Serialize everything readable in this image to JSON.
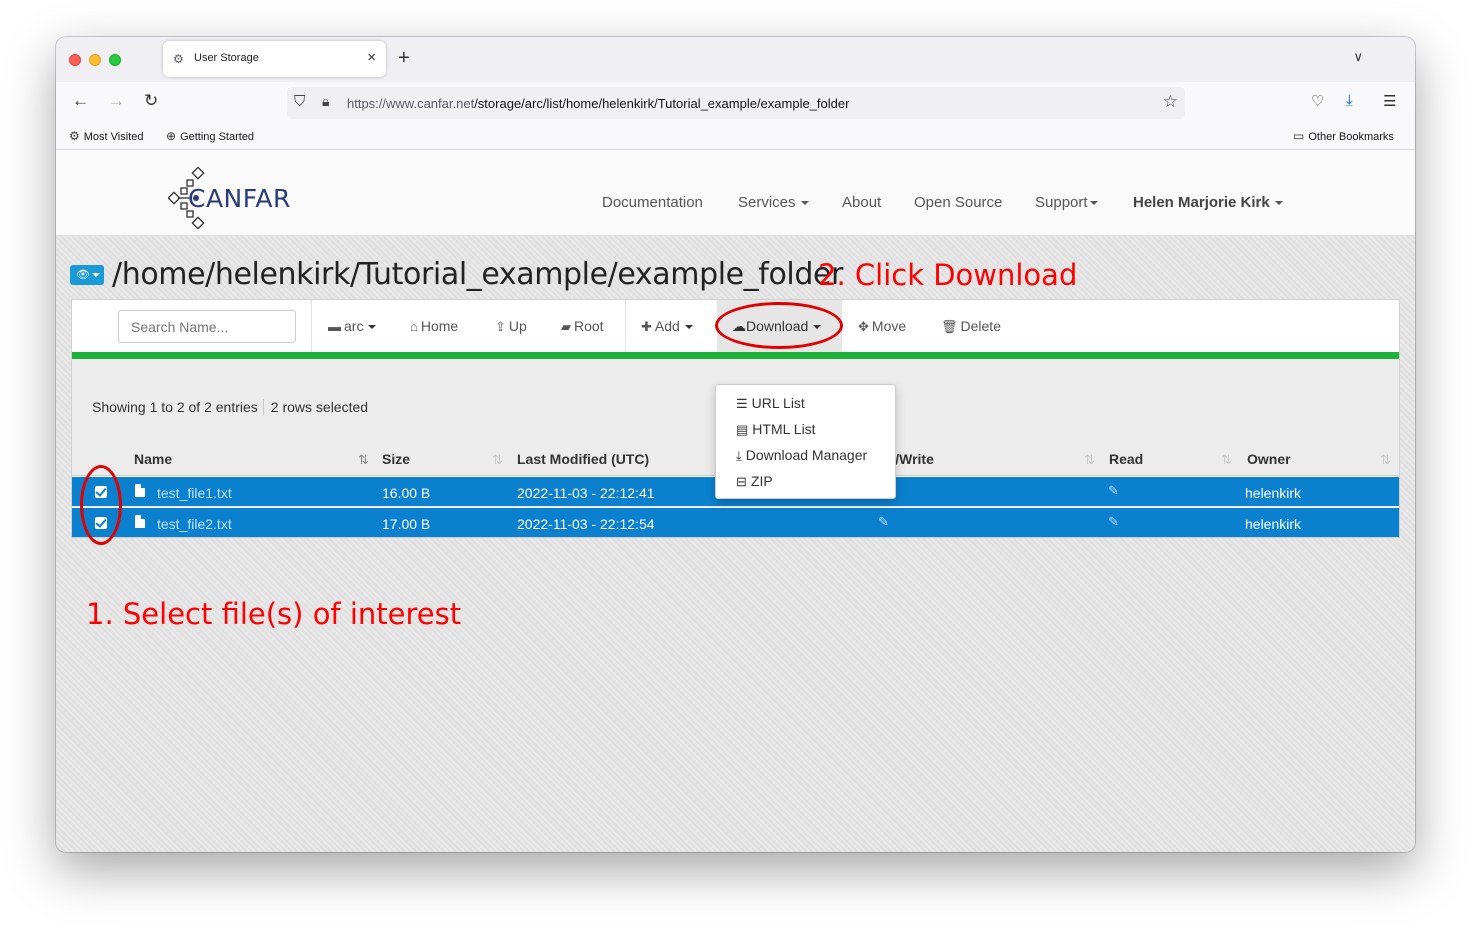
{
  "browser": {
    "tab_title": "User Storage",
    "url_host": "https://www.canfar.net",
    "url_path": "/storage/arc/list/home/helenkirk/Tutorial_example/example_folder",
    "bookmarks": [
      "Most Visited",
      "Getting Started"
    ],
    "other_bookmarks": "Other Bookmarks"
  },
  "site": {
    "logo": "CANFAR",
    "nav": [
      "Documentation",
      "Services",
      "About",
      "Open Source",
      "Support"
    ],
    "user": "Helen Marjorie Kirk"
  },
  "page": {
    "path": "/home/helenkirk/Tutorial_example/example_folder",
    "annotation_download": "2. Click Download",
    "annotation_select": "1. Select file(s) of interest"
  },
  "toolbar": {
    "search_placeholder": "Search Name...",
    "arc": "arc",
    "home": "Home",
    "up": "Up",
    "root": "Root",
    "add": "Add",
    "download": "Download",
    "move": "Move",
    "delete": "Delete"
  },
  "download_menu": [
    "URL List",
    "HTML List",
    "Download Manager",
    "ZIP"
  ],
  "table": {
    "showing": "Showing 1 to 2 of 2 entries",
    "selected": "2 rows selected",
    "columns": [
      "Name",
      "Size",
      "Last Modified (UTC)",
      "Read/Write",
      "Read",
      "Owner"
    ],
    "rows": [
      {
        "name": "test_file1.txt",
        "size": "16.00 B",
        "modified": "2022-11-03 - 22:12:41",
        "owner": "helenkirk"
      },
      {
        "name": "test_file2.txt",
        "size": "17.00 B",
        "modified": "2022-11-03 - 22:12:54",
        "owner": "helenkirk"
      }
    ]
  },
  "colors": {
    "selected_row": "#0a80cf",
    "accent_green": "#1db33a",
    "annotation_red": "#ff0000"
  }
}
